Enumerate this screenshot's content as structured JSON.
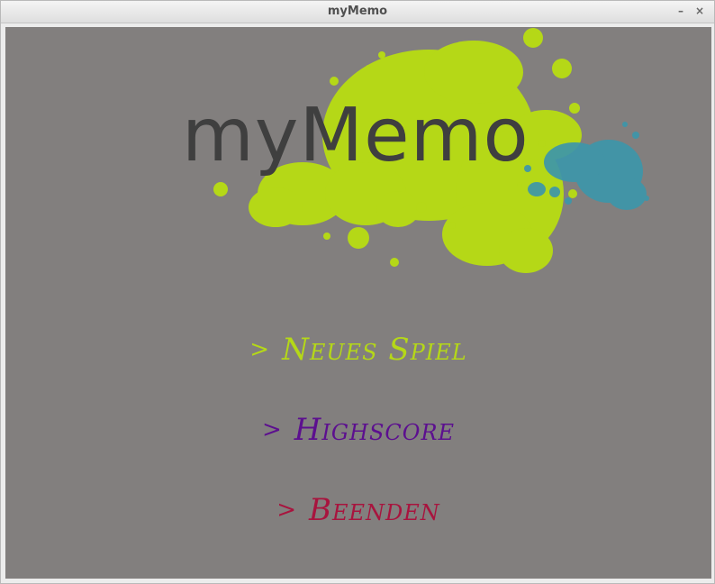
{
  "window": {
    "title": "myMemo",
    "minimize_glyph": "–",
    "close_glyph": "×"
  },
  "logo": {
    "text": "myMemo",
    "splash_colors": {
      "green": "#b5d817",
      "blue": "#3d96aa",
      "text": "#3f3f3f"
    }
  },
  "menu": {
    "items": [
      {
        "arrow": ">",
        "label": "Neues Spiel",
        "color": "#b5d817"
      },
      {
        "arrow": ">",
        "label": "Highscore",
        "color": "#5c0f8f"
      },
      {
        "arrow": ">",
        "label": "Beenden",
        "color": "#a8143e"
      }
    ]
  }
}
